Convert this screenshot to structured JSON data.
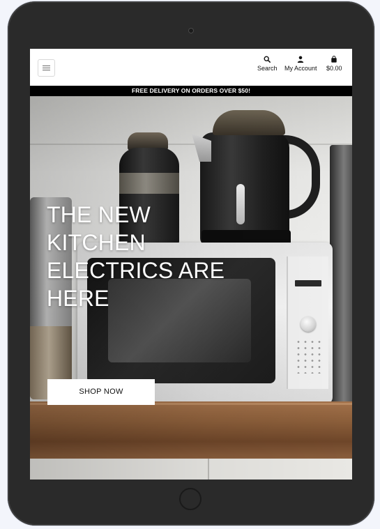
{
  "header": {
    "nav": {
      "search_label": "Search",
      "account_label": "My Account",
      "cart_label": "$0.00"
    }
  },
  "banner": {
    "text": "FREE DELIVERY ON ORDERS OVER $50!"
  },
  "hero": {
    "title": "THE NEW KITCHEN ELECTRICS ARE HERE",
    "cta_label": "SHOP NOW"
  },
  "colors": {
    "banner_bg": "#000000",
    "button_bg": "#ffffff",
    "device_frame": "#2a2a2a"
  },
  "icons": [
    "hamburger-menu-icon",
    "search-icon",
    "user-icon",
    "shopping-bag-icon"
  ]
}
